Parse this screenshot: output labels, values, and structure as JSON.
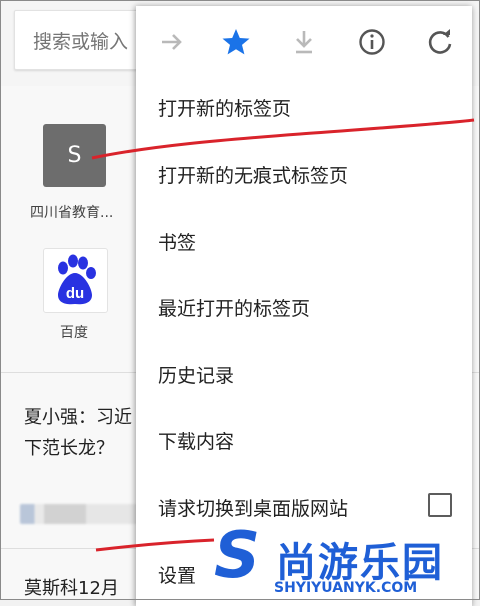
{
  "background_page": {
    "search_placeholder": "搜索或输入",
    "shortcuts": [
      {
        "letter": "S",
        "label": "四川省教育..."
      },
      {
        "letter": "du",
        "label": "百度"
      }
    ],
    "news": [
      {
        "line1": "夏小强：习近",
        "line2": "下范长龙？"
      },
      {
        "line1": "莫斯科12月"
      }
    ]
  },
  "menu": {
    "toolbar_icons": [
      "forward-arrow-icon",
      "star-icon",
      "download-icon",
      "info-icon",
      "refresh-icon"
    ],
    "items": [
      {
        "label": "打开新的标签页"
      },
      {
        "label": "打开新的无痕式标签页"
      },
      {
        "label": "书签"
      },
      {
        "label": "最近打开的标签页"
      },
      {
        "label": "历史记录"
      },
      {
        "label": "下载内容"
      },
      {
        "label": "请求切换到桌面版网站",
        "checked": false
      },
      {
        "label": "设置"
      }
    ]
  },
  "colors": {
    "star_accent": "#1a73e8",
    "annotation_red": "#d9232b",
    "watermark_blue": "#1f5fd6",
    "baidu_blue": "#2932e1"
  },
  "watermark": {
    "cn_text": "尚游乐园",
    "en_text": "SHYIYUANYK.COM",
    "logo_letter": "S"
  }
}
